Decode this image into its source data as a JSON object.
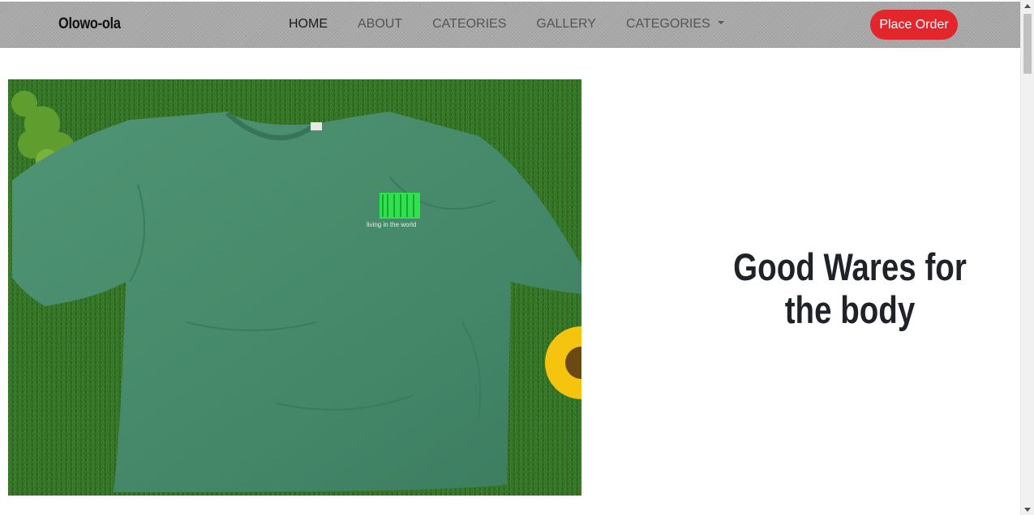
{
  "navbar": {
    "brand": "Olowo-ola",
    "links": [
      {
        "label": "HOME",
        "active": true
      },
      {
        "label": "ABOUT",
        "active": false
      },
      {
        "label": "CATEORIES",
        "active": false
      },
      {
        "label": "GALLERY",
        "active": false
      },
      {
        "label": "CATEGORIES",
        "active": false,
        "dropdown": true
      }
    ],
    "cta_label": "Place Order"
  },
  "hero": {
    "headline": "Good Wares for the body",
    "image_print_text": "living in the world"
  },
  "colors": {
    "navbar_bg": "#a9a9a9",
    "cta_bg": "#e3262b",
    "headline": "#1f2329"
  },
  "icons": {
    "dropdown": "caret-down-icon"
  }
}
